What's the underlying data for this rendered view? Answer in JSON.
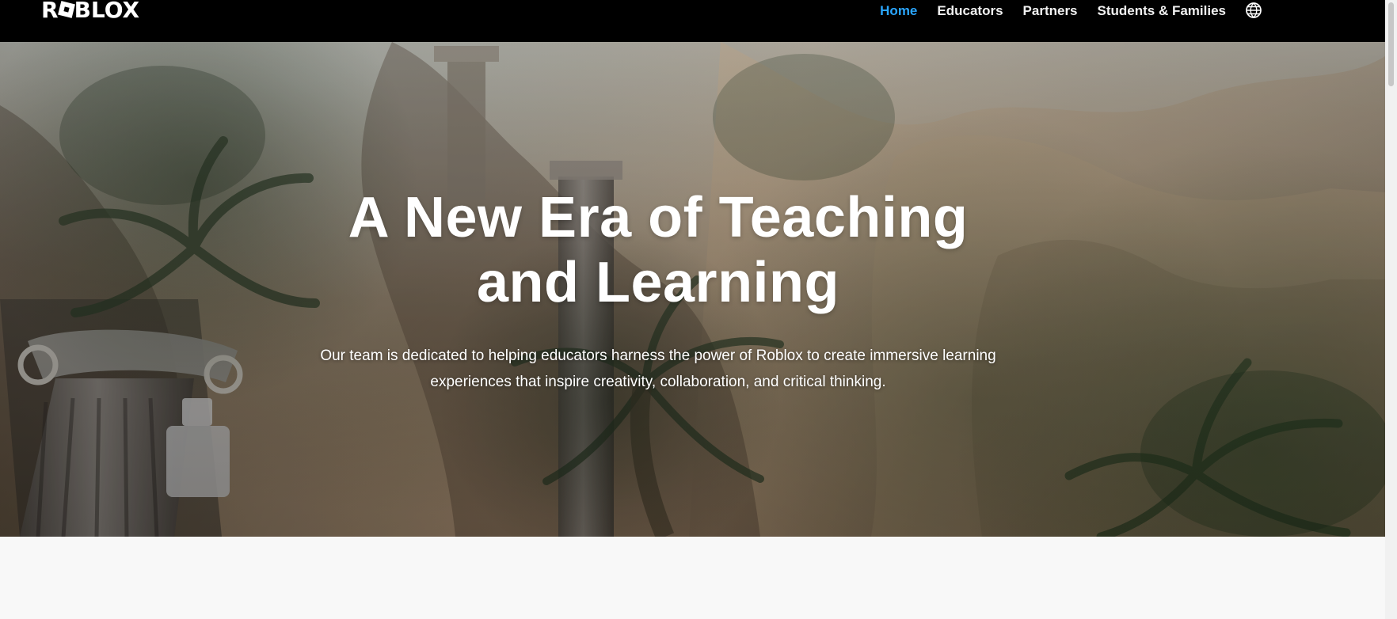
{
  "brand": {
    "logo_text_left": "R",
    "logo_text_right": "BLOX"
  },
  "nav": {
    "items": [
      {
        "label": "Home",
        "active": true
      },
      {
        "label": "Educators",
        "active": false
      },
      {
        "label": "Partners",
        "active": false
      },
      {
        "label": "Students & Families",
        "active": false
      }
    ],
    "language_icon": "globe-icon"
  },
  "hero": {
    "title": "A New Era of Teaching and Learning",
    "subtitle": "Our team is dedicated to helping educators harness the power of Roblox to create immersive learning experiences that inspire creativity, collaboration, and critical thinking."
  },
  "colors": {
    "nav_background": "#000000",
    "active_link": "#2AA6FF",
    "page_background": "#F8F8F8"
  }
}
